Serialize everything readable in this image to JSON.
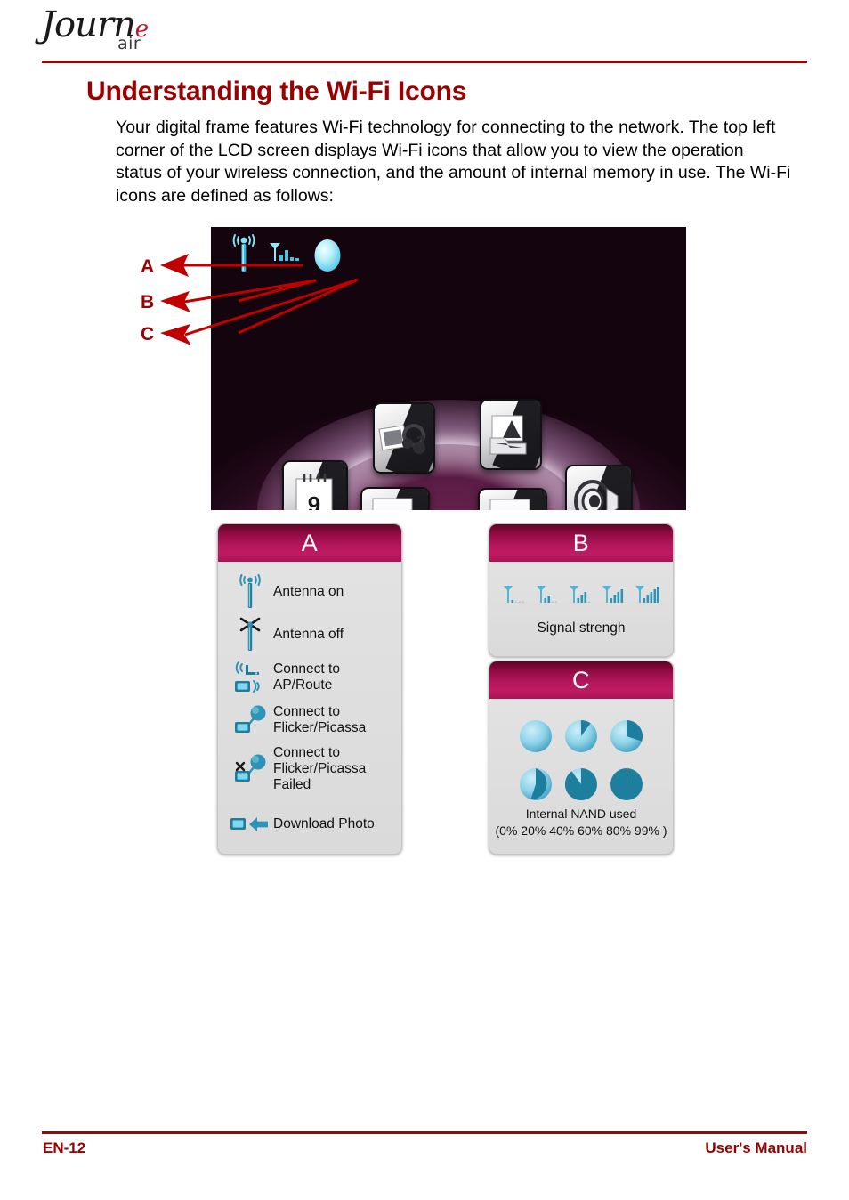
{
  "header": {
    "logo_text": "Journ",
    "logo_accent_letter": "e",
    "logo_sub": "air",
    "rule_color": "#8f0b0b"
  },
  "title": "Understanding the Wi-Fi Icons",
  "body_paragraph": "Your digital frame features Wi-Fi technology for connecting to the network. The top left corner of the LCD screen displays Wi-Fi icons that allow you to view the operation status of your wireless connection, and the amount of internal memory in use. The Wi-Fi icons are defined as follows:",
  "figure": {
    "callouts": [
      {
        "label": "A",
        "target": "antenna-tower-icon"
      },
      {
        "label": "B",
        "target": "signal-bars-icon"
      },
      {
        "label": "C",
        "target": "nand-circle-icon"
      }
    ],
    "photo_description": "Digital photo frame LCD showing carousel menu",
    "status_icons": [
      "antenna-tower",
      "signal-bars",
      "nand-circle"
    ],
    "menu_icons": [
      "photo-music",
      "folder",
      "calendar-9",
      "speaker",
      "photo-a",
      "photo-b"
    ],
    "calendar_day": "9"
  },
  "legend_a": {
    "letter": "A",
    "rows": [
      {
        "icon": "antenna-on-icon",
        "text": "Antenna on"
      },
      {
        "icon": "antenna-off-icon",
        "text": "Antenna off"
      },
      {
        "icon": "ap-route-icon",
        "text": "Connect to\nAP/Route"
      },
      {
        "icon": "flicker-picassa-icon",
        "text": "Connect to\nFlicker/Picassa"
      },
      {
        "icon": "flicker-picassa-failed-icon",
        "text": "Connect to\nFlicker/Picassa Failed"
      },
      {
        "icon": "download-photo-icon",
        "text": "Download Photo"
      }
    ]
  },
  "legend_b": {
    "letter": "B",
    "caption": "Signal strengh",
    "levels": [
      1,
      2,
      3,
      4,
      5
    ],
    "bars_per_icon": 5
  },
  "legend_c": {
    "letter": "C",
    "caption": "Internal NAND used",
    "caption_values": "(0% 20% 40% 60% 80% 99% )",
    "percentages": [
      0,
      20,
      40,
      60,
      80,
      99
    ]
  },
  "footer": {
    "left": "EN-12",
    "right": "User's Manual"
  },
  "colors": {
    "accent_red": "#9b0000",
    "header_magenta": "#b3175c",
    "icon_teal": "#2d8aa8",
    "legend_bg": "#dcdcdc"
  }
}
